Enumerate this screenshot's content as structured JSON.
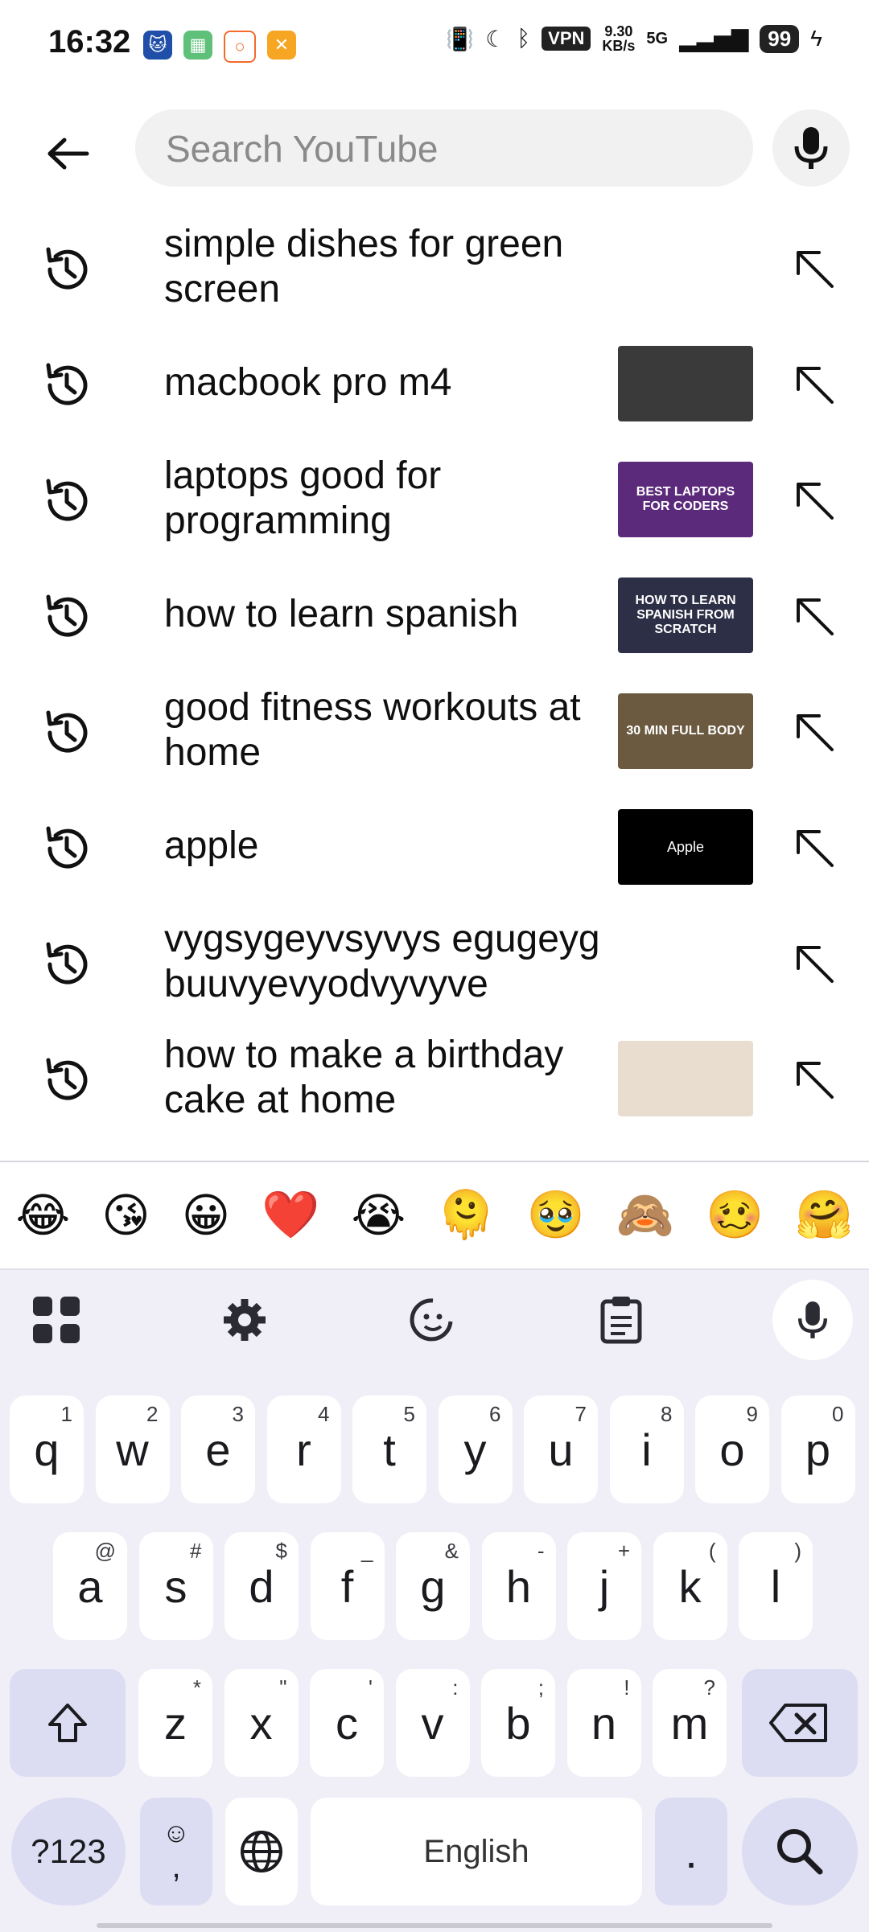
{
  "status_bar": {
    "time": "16:32",
    "vpn": "VPN",
    "speed_value": "9.30",
    "speed_unit": "KB/s",
    "network": "5G",
    "battery": "99"
  },
  "search": {
    "placeholder": "Search YouTube",
    "value": ""
  },
  "suggestions": [
    {
      "text": "simple dishes for green screen",
      "thumbnail": null
    },
    {
      "text": "macbook pro m4",
      "thumbnail": {
        "bg": "#3a3a3a",
        "caption": ""
      }
    },
    {
      "text": "laptops good for programming",
      "thumbnail": {
        "bg": "#5b2a7a",
        "caption": "BEST LAPTOPS FOR CODERS"
      }
    },
    {
      "text": "how to learn spanish",
      "thumbnail": {
        "bg": "#2c2f45",
        "caption": "HOW TO LEARN SPANISH FROM SCRATCH"
      }
    },
    {
      "text": "good fitness workouts at home",
      "thumbnail": {
        "bg": "#6b5a40",
        "caption": "30 MIN FULL BODY"
      }
    },
    {
      "text": "apple",
      "thumbnail": {
        "bg": "#000000",
        "caption": "Apple"
      }
    },
    {
      "text": "vygsygeyvsyvys egugeyg buuvyevyodvyvyve",
      "thumbnail": null
    },
    {
      "text": "how to make a birthday cake at home",
      "thumbnail": {
        "bg": "#e9ddd0",
        "caption": ""
      }
    }
  ],
  "keyboard": {
    "emojis": [
      "😂",
      "😘",
      "😀",
      "❤️",
      "😭",
      "🫠",
      "🥹",
      "🙈",
      "🥴",
      "🤗"
    ],
    "rows": [
      [
        {
          "k": "q",
          "h": "1"
        },
        {
          "k": "w",
          "h": "2"
        },
        {
          "k": "e",
          "h": "3"
        },
        {
          "k": "r",
          "h": "4"
        },
        {
          "k": "t",
          "h": "5"
        },
        {
          "k": "y",
          "h": "6"
        },
        {
          "k": "u",
          "h": "7"
        },
        {
          "k": "i",
          "h": "8"
        },
        {
          "k": "o",
          "h": "9"
        },
        {
          "k": "p",
          "h": "0"
        }
      ],
      [
        {
          "k": "a",
          "h": "@"
        },
        {
          "k": "s",
          "h": "#"
        },
        {
          "k": "d",
          "h": "$"
        },
        {
          "k": "f",
          "h": "_"
        },
        {
          "k": "g",
          "h": "&"
        },
        {
          "k": "h",
          "h": "-"
        },
        {
          "k": "j",
          "h": "+"
        },
        {
          "k": "k",
          "h": "("
        },
        {
          "k": "l",
          "h": ")"
        }
      ],
      [
        {
          "k": "z",
          "h": "*"
        },
        {
          "k": "x",
          "h": "\""
        },
        {
          "k": "c",
          "h": "'"
        },
        {
          "k": "v",
          "h": ":"
        },
        {
          "k": "b",
          "h": ";"
        },
        {
          "k": "n",
          "h": "!"
        },
        {
          "k": "m",
          "h": "?"
        }
      ]
    ],
    "symbols_key": "?123",
    "comma": ",",
    "space_label": "English",
    "period": "."
  },
  "colors": {
    "keyboard_bg": "#f0eff7",
    "modifier_key": "#dcdcf3",
    "accent": "#dcdcf3"
  }
}
